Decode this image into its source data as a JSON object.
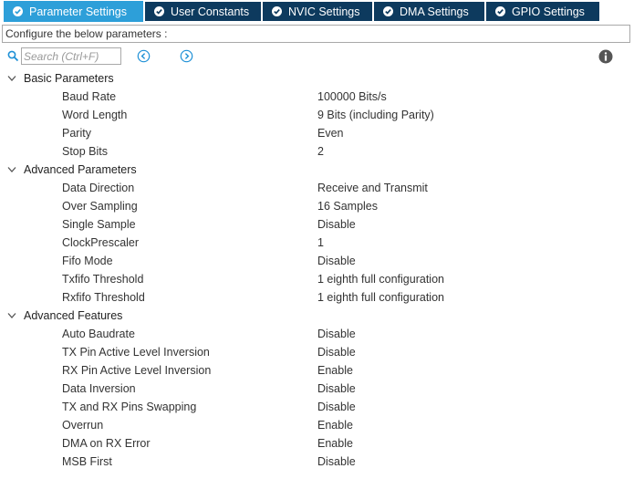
{
  "tabs": [
    {
      "label": "Parameter Settings",
      "active": true
    },
    {
      "label": "User Constants",
      "active": false
    },
    {
      "label": "NVIC Settings",
      "active": false
    },
    {
      "label": "DMA Settings",
      "active": false
    },
    {
      "label": "GPIO Settings",
      "active": false
    }
  ],
  "hint": "Configure the below parameters :",
  "search": {
    "placeholder": "Search (Ctrl+F)",
    "value": ""
  },
  "groups": [
    {
      "label": "Basic Parameters",
      "params": [
        {
          "name": "Baud Rate",
          "value": "100000 Bits/s"
        },
        {
          "name": "Word Length",
          "value": "9 Bits (including Parity)"
        },
        {
          "name": "Parity",
          "value": "Even"
        },
        {
          "name": "Stop Bits",
          "value": "2"
        }
      ]
    },
    {
      "label": "Advanced Parameters",
      "params": [
        {
          "name": "Data Direction",
          "value": "Receive and Transmit"
        },
        {
          "name": "Over Sampling",
          "value": "16 Samples"
        },
        {
          "name": "Single Sample",
          "value": "Disable"
        },
        {
          "name": "ClockPrescaler",
          "value": "1"
        },
        {
          "name": "Fifo Mode",
          "value": "Disable"
        },
        {
          "name": "Txfifo Threshold",
          "value": "1 eighth full configuration"
        },
        {
          "name": "Rxfifo Threshold",
          "value": "1 eighth full configuration"
        }
      ]
    },
    {
      "label": "Advanced Features",
      "params": [
        {
          "name": "Auto Baudrate",
          "value": "Disable"
        },
        {
          "name": "TX Pin Active Level Inversion",
          "value": "Disable"
        },
        {
          "name": "RX Pin Active Level Inversion",
          "value": "Enable"
        },
        {
          "name": "Data Inversion",
          "value": "Disable"
        },
        {
          "name": "TX and RX Pins Swapping",
          "value": "Disable"
        },
        {
          "name": "Overrun",
          "value": "Enable"
        },
        {
          "name": "DMA on RX Error",
          "value": "Enable"
        },
        {
          "name": "MSB First",
          "value": "Disable"
        }
      ]
    }
  ],
  "colors": {
    "active_tab": "#2d9fd9",
    "inactive_tab": "#0d3a5e",
    "nav_icon": "#1e90d6",
    "info_icon": "#555555"
  },
  "icons": {
    "tab_check": "check-circle-icon",
    "search": "search-icon",
    "prev": "arrow-left-circle-icon",
    "next": "arrow-right-circle-icon",
    "info": "info-icon",
    "expand": "chevron-down-icon"
  }
}
